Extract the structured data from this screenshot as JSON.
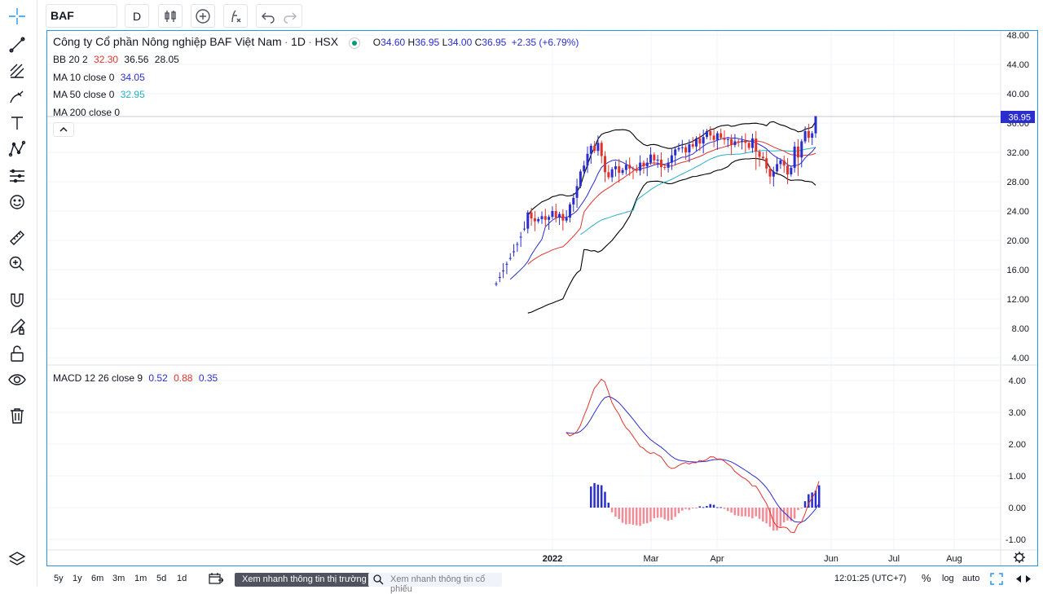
{
  "toolbar": {
    "symbol": "BAF",
    "interval": "D"
  },
  "legend": {
    "title": "Công ty Cổ phần Nông nghiệp BAF Việt Nam",
    "dot1": "·",
    "interval": "1D",
    "dot2": "·",
    "exchange": "HSX",
    "o_label": "O",
    "o_value": "34.60",
    "h_label": "H",
    "h_value": "36.95",
    "l_label": "L",
    "l_value": "34.00",
    "c_label": "C",
    "c_value": "36.95",
    "change": "+2.35 (+6.79%)",
    "bb_label": "BB 20 2",
    "bb_mid": "32.30",
    "bb_upper": "36.56",
    "bb_lower": "28.05",
    "ma10_label": "MA 10 close 0",
    "ma10_value": "34.05",
    "ma50_label": "MA 50 close 0",
    "ma50_value": "32.95",
    "ma200_label": "MA 200 close 0",
    "macd_label": "MACD 12 26 close 9",
    "macd_value": "0.52",
    "macd_signal": "0.88",
    "macd_hist": "0.35"
  },
  "price_axis": [
    "48.00",
    "44.00",
    "40.00",
    "36.00",
    "32.00",
    "28.00",
    "24.00",
    "20.00",
    "16.00",
    "12.00",
    "8.00",
    "4.00"
  ],
  "last_price_tag": "36.95",
  "macd_axis": [
    "4.00",
    "3.00",
    "2.00",
    "1.00",
    "0.00",
    "-1.00"
  ],
  "time_axis": [
    {
      "label": "2022",
      "bold": true
    },
    {
      "label": "Mar",
      "bold": false
    },
    {
      "label": "Apr",
      "bold": false
    },
    {
      "label": "Jun",
      "bold": false
    },
    {
      "label": "Jul",
      "bold": false
    },
    {
      "label": "Aug",
      "bold": false
    }
  ],
  "bottom": {
    "ranges": [
      "5y",
      "1y",
      "6m",
      "3m",
      "1m",
      "5d",
      "1d"
    ],
    "market_button": "Xem nhanh thông tin thị trường",
    "stock_search_placeholder": "Xem nhanh thông tin cổ phiếu",
    "clock": "12:01:25 (UTC+7)",
    "percent": "%",
    "log": "log",
    "auto": "auto"
  },
  "colors": {
    "accent": "#2196f3",
    "up": "#2a2ecd",
    "down": "#e0332d",
    "ma10": "#2a2ecd",
    "ma50": "#26b0c8",
    "bb": "#000000",
    "bb_mid": "#e0332d",
    "macd": "#2a2ecd",
    "signal": "#e0332d",
    "hist_neg": "#f28b96",
    "hist_pos": "#2a2ecd"
  },
  "chart_data": {
    "type": "candlestick",
    "price_range": [
      4,
      48
    ],
    "macd_range": [
      -1,
      4
    ],
    "ohlc_last": {
      "o": 34.6,
      "h": 36.95,
      "l": 34.0,
      "c": 36.95
    },
    "close_series": [
      14.1,
      15.0,
      15.9,
      16.8,
      17.6,
      18.5,
      19.5,
      20.5,
      21.6,
      23.8,
      23.0,
      22.6,
      22.9,
      23.3,
      22.8,
      23.2,
      24.0,
      23.1,
      23.6,
      22.7,
      23.1,
      24.9,
      25.8,
      27.4,
      29.4,
      30.2,
      31.8,
      32.9,
      32.2,
      33.3,
      31.5,
      29.3,
      28.6,
      29.7,
      30.1,
      29.2,
      29.6,
      30.3,
      29.8,
      29.7,
      29.5,
      30.6,
      30.1,
      30.6,
      31.7,
      30.9,
      31.0,
      30.0,
      29.9,
      30.6,
      31.6,
      32.4,
      32.6,
      32.7,
      32.0,
      33.1,
      32.8,
      33.9,
      33.2,
      34.1,
      34.9,
      34.3,
      33.7,
      34.6,
      34.0,
      33.7,
      33.8,
      33.0,
      33.5,
      33.4,
      33.6,
      33.3,
      32.6,
      33.9,
      32.1,
      31.4,
      31.2,
      29.8,
      28.7,
      29.4,
      30.4,
      30.9,
      30.2,
      29.0,
      29.9,
      32.8,
      31.3,
      33.5,
      34.9,
      34.0,
      34.6,
      36.95
    ],
    "ma10_last": 34.05,
    "ma50_last": 32.95,
    "bb_last": {
      "mid": 32.3,
      "upper": 36.56,
      "lower": 28.05
    },
    "macd_last": {
      "macd": 0.52,
      "signal": 0.88,
      "hist": 0.35
    }
  }
}
